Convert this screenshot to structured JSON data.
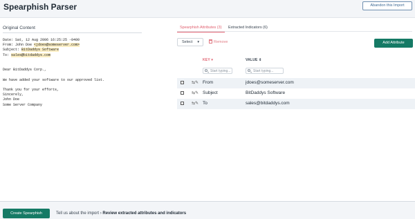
{
  "header": {
    "title": "Spearphish Parser",
    "abandon_label": "Abandon this Import"
  },
  "left": {
    "title": "Original Content",
    "email": {
      "date_line": "Date: Sat, 12 Aug 2006 16:25:25 -0400",
      "from_prefix": "From: John Doe ",
      "from_value": "<jdoes@someserver.com>",
      "subject_prefix": "Subject: ",
      "subject_value": "BitDaddys Software",
      "to_prefix": "To: ",
      "to_value": "sales@bitdaddys.com",
      "body_lines": [
        "Dear BitDaddys Corp.,",
        "",
        "We have added your software to our approved list.",
        "",
        "Thank you for your efforts,",
        "Sincerely,",
        "John Doe",
        "Some Server Company"
      ]
    }
  },
  "right": {
    "tabs": [
      {
        "label": "Spearphish Attributes (3)",
        "active": true
      },
      {
        "label": "Extracted Indicators (6)",
        "active": false
      }
    ],
    "toolbar": {
      "select_label": "Select",
      "remove_label": "Remove",
      "add_label": "Add Attribute"
    },
    "columns": {
      "key": "KEY",
      "value": "VALUE"
    },
    "filters": {
      "key_placeholder": "Start typing...",
      "value_placeholder": "Start typing..."
    },
    "rows": [
      {
        "key": "From",
        "value": "jdoes@someserver.com"
      },
      {
        "key": "Subject",
        "value": "BitDaddys Software"
      },
      {
        "key": "To",
        "value": "sales@bitdaddys.com"
      }
    ]
  },
  "footer": {
    "create_label": "Create Spearphish",
    "step_prev": "Tell us about the import",
    "step_sep": "›",
    "step_current": "Review extracted attributes and indicators"
  },
  "colors": {
    "accent_green": "#157a65",
    "accent_red": "#e0606f",
    "highlight": "#fbeec3"
  }
}
